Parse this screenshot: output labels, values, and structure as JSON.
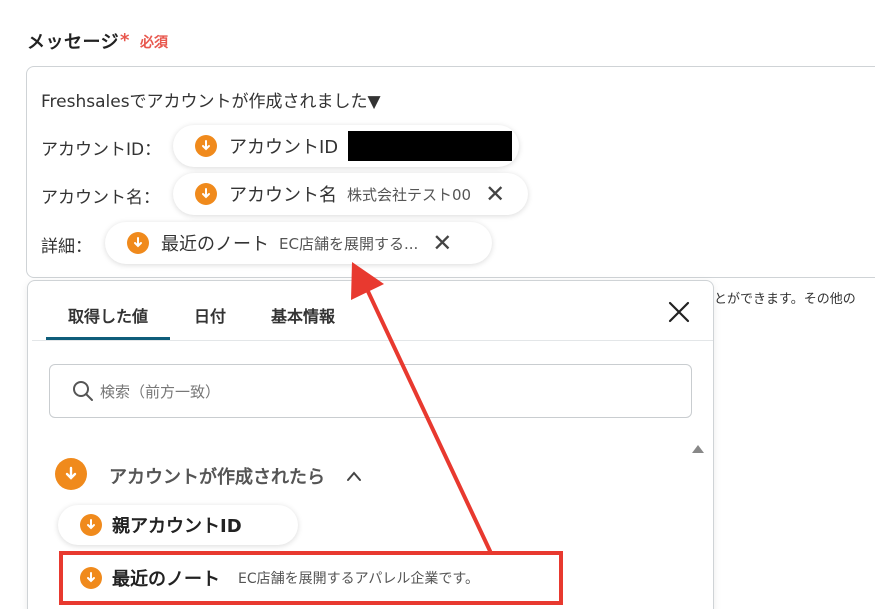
{
  "field": {
    "label": "メッセージ",
    "required_star": "*",
    "required_text": "必須"
  },
  "message": {
    "line1": "Freshsalesでアカウントが作成されました▼",
    "account_id_prefix": "アカウントID：",
    "account_name_prefix": "アカウント名：",
    "detail_prefix": "詳細："
  },
  "chips": {
    "account_id": {
      "label": "アカウントID"
    },
    "account_name": {
      "label": "アカウント名",
      "value": "株式会社テスト00"
    },
    "recent_note": {
      "label": "最近のノート",
      "value": "EC店舗を展開する..."
    }
  },
  "behind_text": "とができます。その他の",
  "panel": {
    "tabs": [
      "取得した値",
      "日付",
      "基本情報"
    ],
    "active_tab": "取得した値",
    "search_placeholder": "検索（前方一致）",
    "section_title": "アカウントが作成されたら",
    "items": [
      {
        "label": "親アカウントID"
      },
      {
        "label": "最近のノート",
        "value": "EC店舗を展開するアパレル企業です。"
      }
    ]
  },
  "colors": {
    "accent": "#f08a1c",
    "tab_active": "#0f5d7a",
    "highlight": "#e8392f",
    "required": "#e8574d"
  },
  "icons": {
    "chip_icon": "freshsales-icon",
    "close": "close-icon",
    "search": "search-icon",
    "chevron": "chevron-up-icon"
  }
}
